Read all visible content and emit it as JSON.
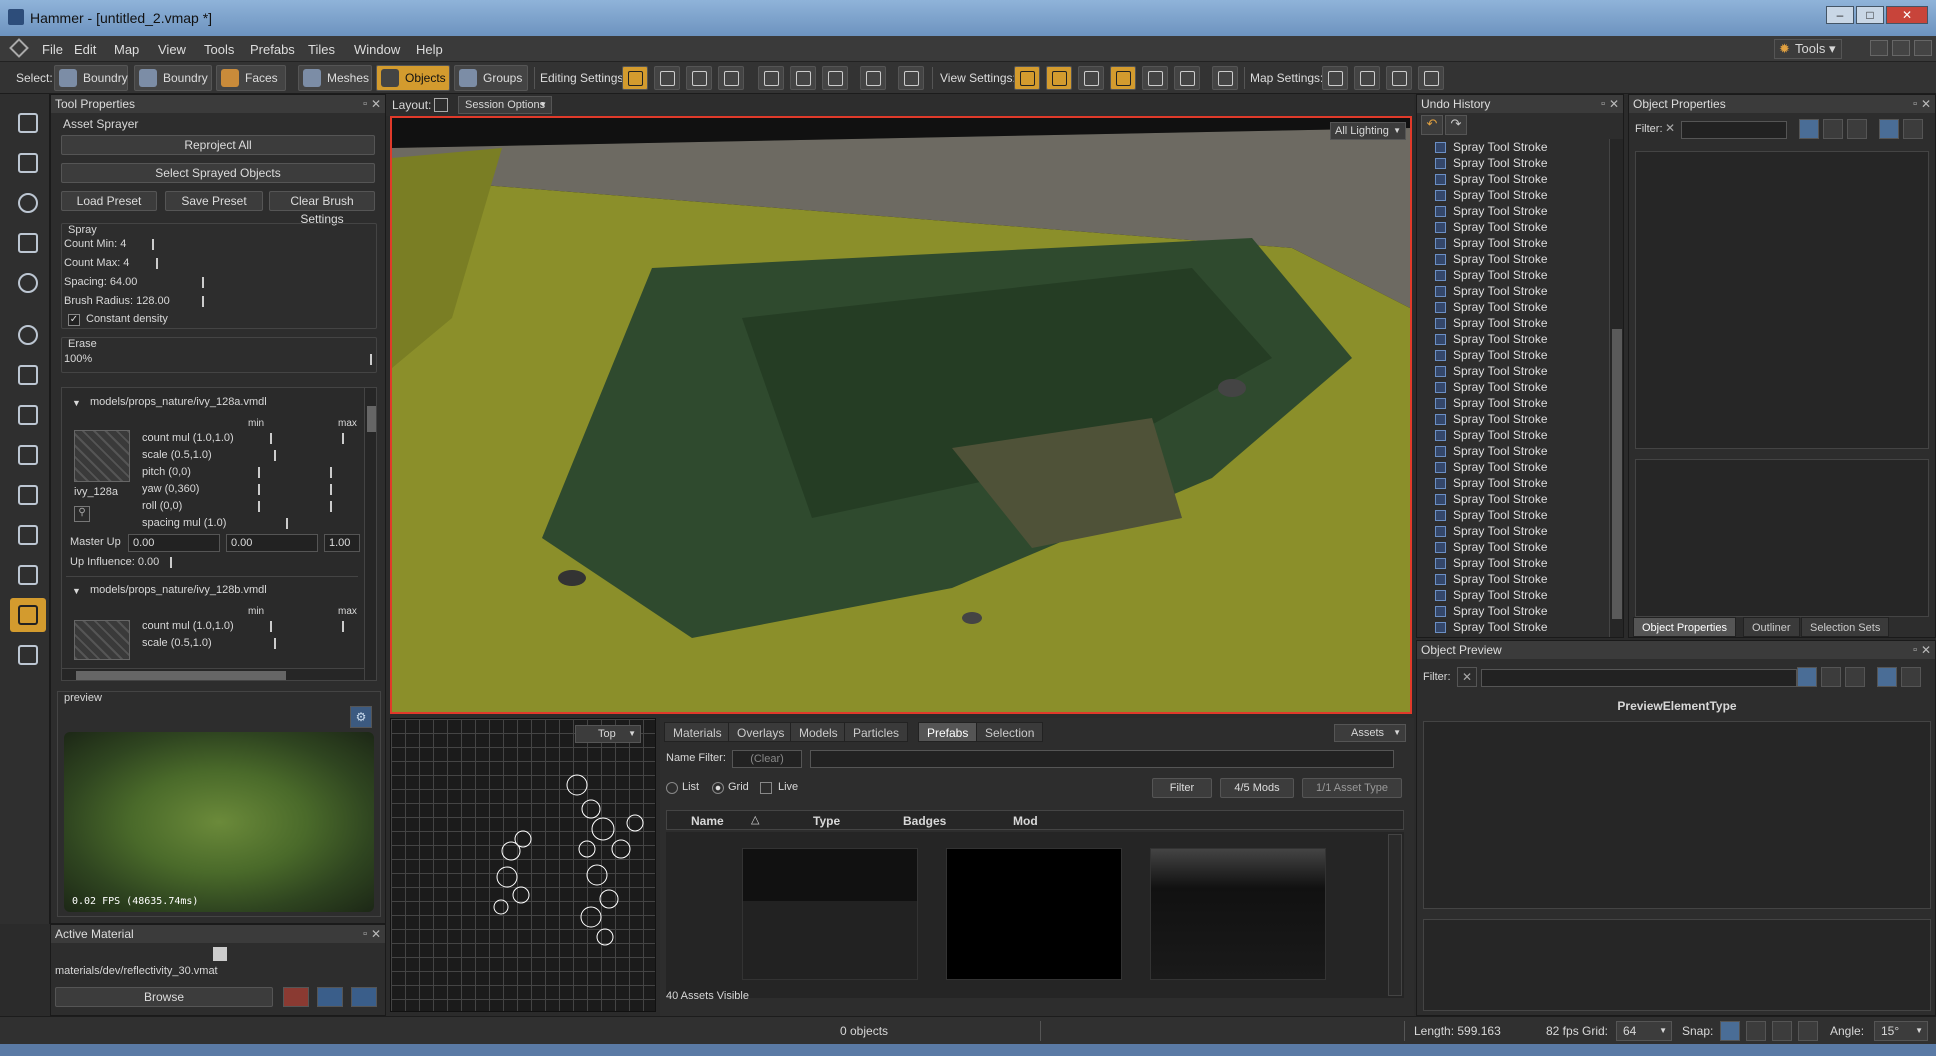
{
  "window": {
    "title": "Hammer - [untitled_2.vmap *]",
    "min": "–",
    "max": "□",
    "close": "✕"
  },
  "menu": [
    "File",
    "Edit",
    "Map",
    "View",
    "Tools",
    "Prefabs",
    "Tiles",
    "Window",
    "Help"
  ],
  "menu_right": {
    "tools": "Tools ▾"
  },
  "toolbar": {
    "select_label": "Select:",
    "editing_label": "Editing Settings:",
    "view_label": "View Settings:",
    "map_label": "Map Settings:",
    "select_buttons": [
      {
        "label": "Boundry"
      },
      {
        "label": "Boundry"
      },
      {
        "label": "Faces"
      },
      {
        "label": "Meshes"
      },
      {
        "label": "Objects",
        "active": true
      },
      {
        "label": "Groups"
      }
    ]
  },
  "tool_properties": {
    "title": "Tool Properties",
    "section": "Asset Sprayer",
    "reproject": "Reproject All",
    "select_sprayed": "Select Sprayed Objects",
    "load_preset": "Load Preset",
    "save_preset": "Save Preset",
    "clear_brush": "Clear Brush Settings",
    "spray": {
      "title": "Spray",
      "count_min": "Count Min: 4",
      "count_max": "Count Max: 4",
      "spacing": "Spacing: 64.00",
      "brush_radius": "Brush Radius: 128.00",
      "constant_density": "Constant density"
    },
    "erase": {
      "title": "Erase",
      "value": "100%"
    },
    "models": [
      {
        "path": "models/props_nature/ivy_128a.vmdl",
        "thumb": "ivy_128a",
        "min": "min",
        "max": "max",
        "params": [
          "count mul (1.0,1.0)",
          "scale (0.5,1.0)",
          "pitch (0,0)",
          "yaw (0,360)",
          "roll (0,0)",
          "spacing mul (1.0)"
        ],
        "master_up_label": "Master Up",
        "master_up": [
          "0.00",
          "0.00",
          "1.00"
        ],
        "up_influence": "Up Influence: 0.00"
      },
      {
        "path": "models/props_nature/ivy_128b.vmdl",
        "min": "min",
        "max": "max",
        "params": [
          "count mul (1.0,1.0)",
          "scale (0.5,1.0)"
        ]
      }
    ],
    "preview_title": "preview",
    "preview_fps": "0.02 FPS (48635.74ms)"
  },
  "active_material": {
    "title": "Active Material",
    "path": "materials/dev/reflectivity_30.vmat",
    "browse": "Browse"
  },
  "viewport": {
    "layout_label": "Layout:",
    "session_options": "Session Options",
    "lighting": "All Lighting"
  },
  "minimap": {
    "view": "Top"
  },
  "asset_browser": {
    "tabs": [
      "Materials",
      "Overlays",
      "Models",
      "Particles",
      "Prefabs",
      "Selection"
    ],
    "active_tab": "Prefabs",
    "assets_btn": "Assets",
    "name_filter_label": "Name Filter:",
    "clear": "(Clear)",
    "view_modes": [
      "List",
      "Grid",
      "Live"
    ],
    "filter_btn": "Filter",
    "mods_btn": "4/5 Mods",
    "asset_type_btn": "1/1 Asset Type",
    "columns": [
      "Name",
      "Type",
      "Badges",
      "Mod"
    ],
    "status": "40 Assets Visible"
  },
  "undo_history": {
    "title": "Undo History",
    "item": "Spray Tool Stroke",
    "count": 31
  },
  "object_properties": {
    "title": "Object Properties",
    "filter_label": "Filter:",
    "tabs": [
      "Object Properties",
      "Outliner",
      "Selection Sets"
    ]
  },
  "object_preview": {
    "title": "Object Preview",
    "filter_label": "Filter:",
    "heading": "PreviewElementType"
  },
  "status": {
    "objects": "0 objects",
    "length": "Length: 599.163",
    "fps": "82 fps",
    "grid_label": "Grid:",
    "grid": "64",
    "snap_label": "Snap:",
    "angle_label": "Angle:",
    "angle": "15°"
  },
  "colors": {
    "accent": "#d39b2e",
    "viewport_border": "#e03a2a",
    "grass": "#8b8f2a",
    "tree": "#2f4a2e"
  }
}
